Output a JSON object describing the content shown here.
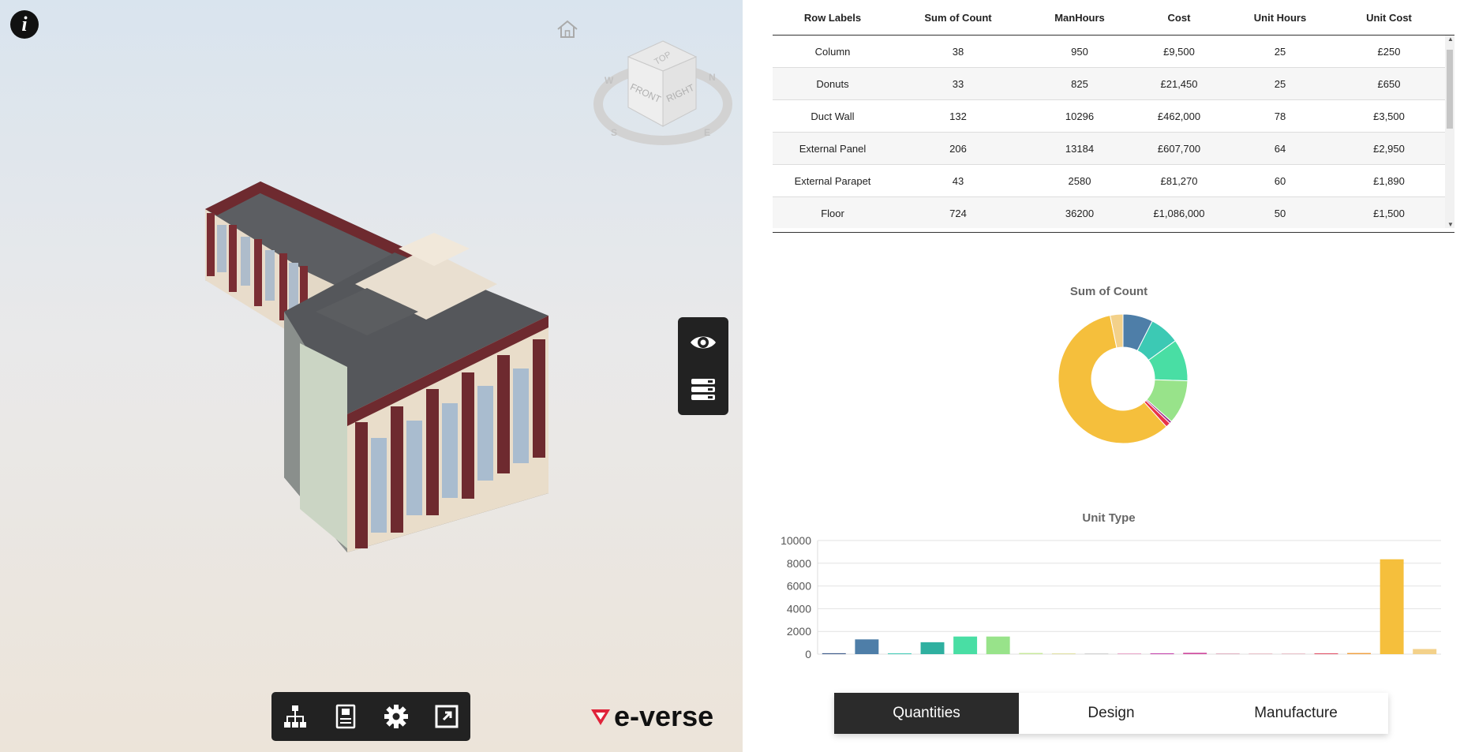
{
  "viewer": {
    "nav_cube": {
      "top": "TOP",
      "front": "FRONT",
      "right": "RIGHT",
      "n": "N",
      "s": "S",
      "e": "E",
      "w": "W"
    },
    "logo_text": "e-verse",
    "side_toolbar": [
      "eye-icon",
      "layers-icon"
    ],
    "bottom_toolbar": [
      "hierarchy-icon",
      "properties-icon",
      "gear-icon",
      "fullscreen-icon"
    ]
  },
  "table": {
    "headers": [
      "Row Labels",
      "Sum of Count",
      "ManHours",
      "Cost",
      "Unit Hours",
      "Unit Cost"
    ],
    "rows": [
      [
        "Column",
        "38",
        "950",
        "£9,500",
        "25",
        "£250"
      ],
      [
        "Donuts",
        "33",
        "825",
        "£21,450",
        "25",
        "£650"
      ],
      [
        "Duct Wall",
        "132",
        "10296",
        "£462,000",
        "78",
        "£3,500"
      ],
      [
        "External Panel",
        "206",
        "13184",
        "£607,700",
        "64",
        "£2,950"
      ],
      [
        "External Parapet",
        "43",
        "2580",
        "£81,270",
        "60",
        "£1,890"
      ],
      [
        "Floor",
        "724",
        "36200",
        "£1,086,000",
        "50",
        "£1,500"
      ]
    ]
  },
  "charts": {
    "donut": {
      "title": "Sum of Count",
      "chart_data": {
        "type": "pie",
        "title": "Sum of Count",
        "slices": [
          {
            "value": 7.5,
            "color": "#4e7ea8"
          },
          {
            "value": 7.5,
            "color": "#3cc9b4"
          },
          {
            "value": 10.5,
            "color": "#49dea4"
          },
          {
            "value": 11,
            "color": "#98e38a"
          },
          {
            "value": 0.6,
            "color": "#9a2a8a"
          },
          {
            "value": 1.2,
            "color": "#e8334a"
          },
          {
            "value": 58.5,
            "color": "#f5bf3c"
          },
          {
            "value": 3.2,
            "color": "#f3d18a"
          }
        ]
      }
    },
    "bar": {
      "title": "Unit Type",
      "chart_data": {
        "type": "bar",
        "title": "Unit Type",
        "ylim": [
          0,
          10000
        ],
        "yticks": [
          "0",
          "2000",
          "4000",
          "6000",
          "8000",
          "10000"
        ],
        "grid": true,
        "values": [
          80,
          1300,
          60,
          1050,
          1550,
          1550,
          100,
          20,
          20,
          30,
          60,
          120,
          20,
          20,
          20,
          70,
          100,
          8350,
          450
        ],
        "colors": [
          "#3d5a8a",
          "#4e7ea8",
          "#3cc9b4",
          "#2fb0a0",
          "#49dea4",
          "#98e38a",
          "#c7e99a",
          "#e0e0a0",
          "#cfcfcf",
          "#e9a3c8",
          "#c23ca8",
          "#d04fa0",
          "#e0b0c0",
          "#e8c0c8",
          "#e8c0c8",
          "#e04a60",
          "#f0a040",
          "#f5bf3c",
          "#f3d18a"
        ]
      }
    }
  },
  "tabs": [
    "Quantities",
    "Design",
    "Manufacture"
  ],
  "active_tab": "Quantities"
}
